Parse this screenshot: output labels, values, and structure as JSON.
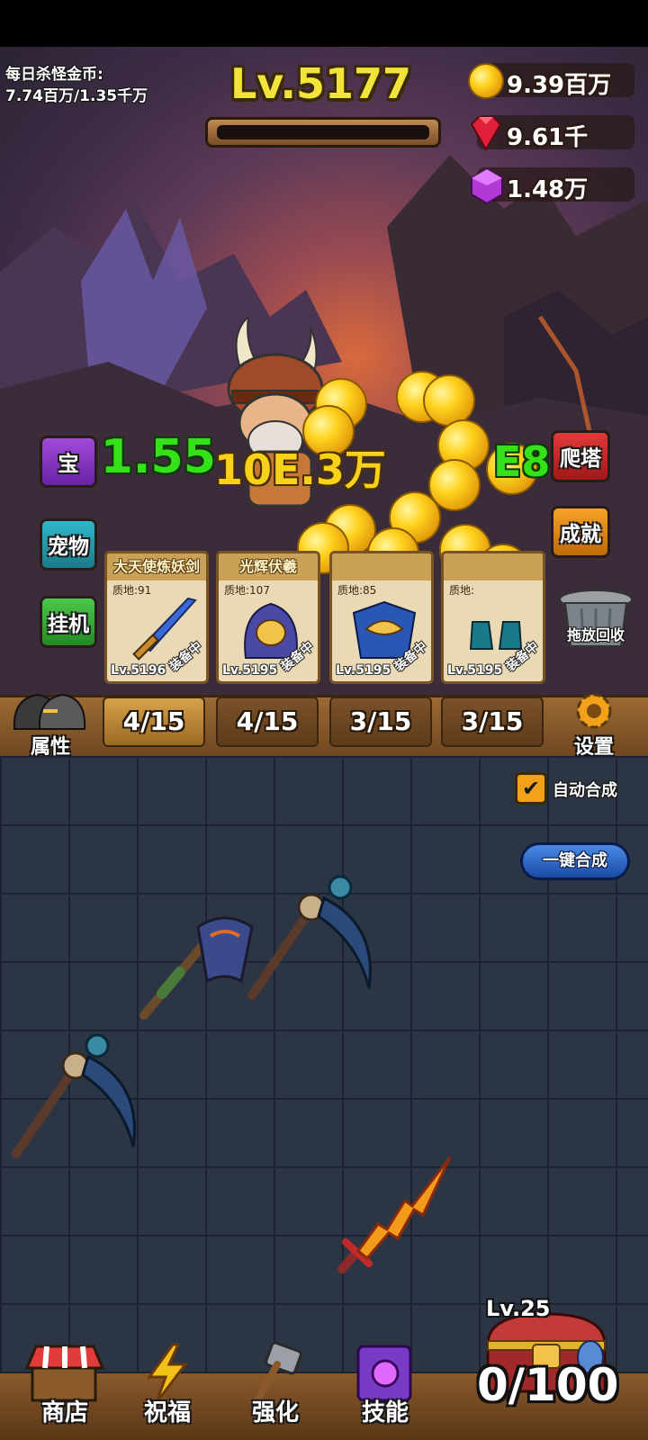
{
  "hud": {
    "daily_label": "每日杀怪金币:",
    "daily_value": "7.74百万/1.35千万",
    "level": "Lv.5177",
    "gold": "9.39百万",
    "gems": "9.61千",
    "crystals": "1.48万"
  },
  "floating": {
    "damage": "+1.55",
    "gold_gain": "10E.3万",
    "tail": "E83"
  },
  "side_left": {
    "treasure": "宝",
    "pet": "宠物",
    "idle": "挂机"
  },
  "side_right": {
    "tower": "爬塔",
    "achievement": "成就",
    "recycle": "拖放回收"
  },
  "cards": [
    {
      "title": "大天使炼妖剑",
      "quality": "质地:91",
      "level": "Lv.5196",
      "status": "装备中"
    },
    {
      "title": "光辉伏羲",
      "quality": "质地:107",
      "level": "Lv.5195",
      "status": "装备中"
    },
    {
      "title": "",
      "quality": "质地:85",
      "level": "Lv.5195",
      "status": "装备中"
    },
    {
      "title": "",
      "quality": "质地:",
      "level": "Lv.5195",
      "status": "装备中"
    }
  ],
  "tabs": {
    "attributes": "属性",
    "counts": [
      "4/15",
      "4/15",
      "3/15",
      "3/15"
    ],
    "settings": "设置"
  },
  "merge": {
    "auto_label": "自动合成",
    "auto_checked": true,
    "one_click": "一键合成"
  },
  "chest": {
    "level": "Lv.25",
    "progress": "0/100"
  },
  "nav": {
    "shop": "商店",
    "blessing": "祝福",
    "upgrade": "强化",
    "skills": "技能"
  }
}
